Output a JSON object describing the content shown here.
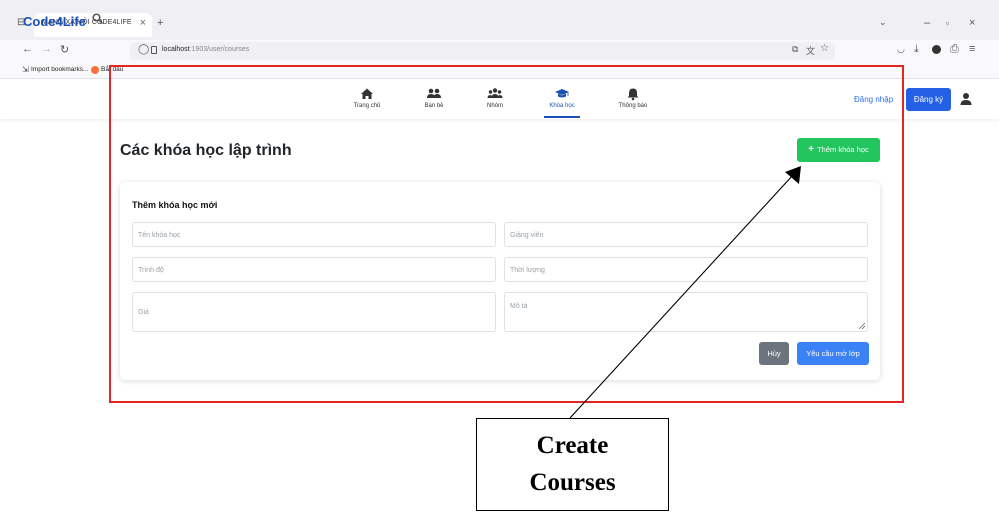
{
  "browser": {
    "tab_title": "MẠNG XÃ HỘI CODE4LIFE",
    "url_host": "localhost",
    "url_rest": ":1903/user/courses",
    "bookmarks": [
      {
        "label": "Import bookmarks..."
      },
      {
        "label": "Bắt đầu"
      }
    ]
  },
  "navbar": {
    "brand": "Code4Life",
    "items": [
      {
        "label": "Trang chủ",
        "icon": "home-icon"
      },
      {
        "label": "Bạn bè",
        "icon": "friends-icon"
      },
      {
        "label": "Nhóm",
        "icon": "group-icon"
      },
      {
        "label": "Khóa học",
        "icon": "graduation-cap-icon",
        "active": true
      },
      {
        "label": "Thông báo",
        "icon": "bell-icon"
      }
    ],
    "login": "Đăng nhập",
    "register": "Đăng ký"
  },
  "main": {
    "title": "Các khóa học lập trình",
    "add_button": "Thêm khóa học",
    "form": {
      "title": "Thêm khóa học mới",
      "fields": {
        "course_name": {
          "placeholder": "Tên khóa học",
          "value": ""
        },
        "instructor": {
          "placeholder": "Giảng viên",
          "value": ""
        },
        "level": {
          "placeholder": "Trình độ",
          "value": ""
        },
        "duration": {
          "placeholder": "Thời lượng",
          "value": ""
        },
        "price": {
          "placeholder": "Giá",
          "value": ""
        },
        "description": {
          "placeholder": "Mô tả",
          "value": ""
        }
      },
      "cancel": "Hủy",
      "submit": "Yêu cầu mở lớp"
    }
  },
  "annotation": {
    "line1": "Create",
    "line2": "Courses"
  },
  "colors": {
    "brand": "#1b4fb3",
    "primary": "#2460e6",
    "success": "#22c55e",
    "secondary": "#6c757d",
    "annotation_frame": "#e32525"
  }
}
